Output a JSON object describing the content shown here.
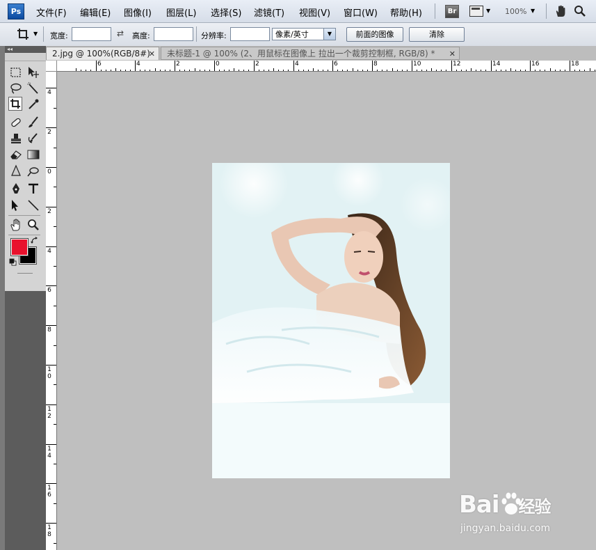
{
  "app": {
    "logo": "Ps"
  },
  "menubar": {
    "items": [
      "文件(F)",
      "编辑(E)",
      "图像(I)",
      "图层(L)",
      "选择(S)",
      "滤镜(T)",
      "视图(V)",
      "窗口(W)",
      "帮助(H)"
    ],
    "bridge_label": "Br",
    "zoom": "100%",
    "icons": [
      "bridge-icon",
      "screen-mode-icon",
      "hand-tool-icon",
      "zoom-tool-icon"
    ]
  },
  "options": {
    "width_label": "宽度:",
    "height_label": "高度:",
    "resolution_label": "分辨率:",
    "width_value": "",
    "height_value": "",
    "resolution_value": "",
    "unit": "像素/英寸",
    "front_image_button": "前面的图像",
    "clear_button": "清除"
  },
  "tabs": [
    {
      "title": "2.jpg @ 100%(RGB/8#)",
      "active": true
    },
    {
      "title": "未标题-1 @ 100% (2、用鼠标在图像上 拉出一个裁剪控制框, RGB/8) *",
      "active": false
    }
  ],
  "ruler": {
    "h_labels": [
      "6",
      "4",
      "2",
      "0",
      "2",
      "4",
      "6",
      "8",
      "10",
      "12",
      "14",
      "16",
      "18"
    ],
    "v_labels": [
      "4",
      "2",
      "0",
      "2",
      "4",
      "6",
      "8",
      "10",
      "12",
      "14",
      "16",
      "18"
    ]
  },
  "colors": {
    "foreground": "#e8112d",
    "background": "#000000"
  },
  "watermark": {
    "brand": "Bai",
    "brand2": "经验",
    "url": "jingyan.baidu.com"
  }
}
